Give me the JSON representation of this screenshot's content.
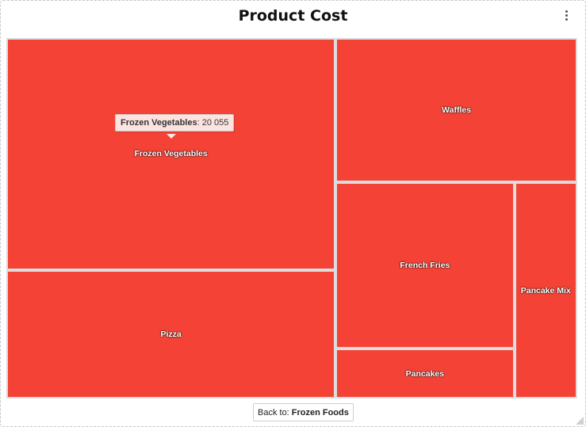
{
  "title": "Product Cost",
  "menu_icon": "more-vertical-icon",
  "tooltip": {
    "name": "Frozen Vegetables",
    "separator": ":",
    "value": "20 055"
  },
  "back_button": {
    "prefix": "Back to:",
    "target": "Frozen Foods"
  },
  "colors": {
    "tile": "#f44336",
    "tile_border": "#dddddd",
    "tooltip_bg": "#fde8e6"
  },
  "chart_data": {
    "type": "treemap",
    "title": "Product Cost",
    "parent": "Frozen Foods",
    "items": [
      {
        "name": "Frozen Vegetables",
        "value": 20055
      },
      {
        "name": "Pizza",
        "value": 11100
      },
      {
        "name": "Waffles",
        "value": 9170
      },
      {
        "name": "French Fries",
        "value": 7790
      },
      {
        "name": "Pancakes",
        "value": 2340
      },
      {
        "name": "Pancake Mix",
        "value": 3570
      }
    ]
  }
}
